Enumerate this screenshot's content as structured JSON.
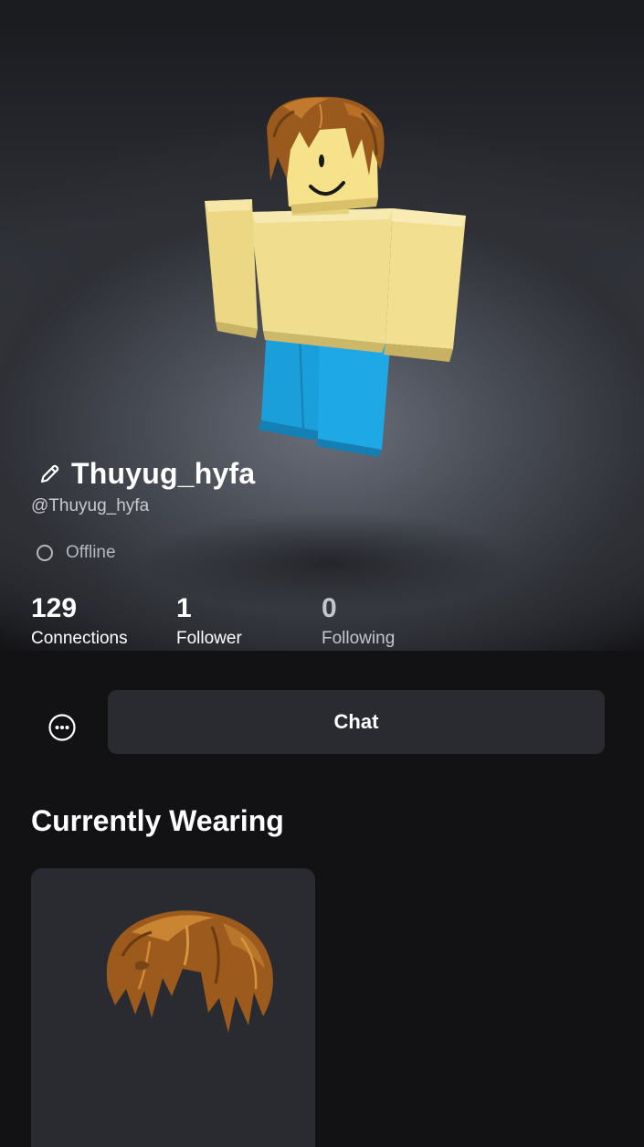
{
  "profile": {
    "display_name": "Thuyug_hyfa",
    "username": "@Thuyug_hyfa",
    "status": "Offline"
  },
  "stats": [
    {
      "value": "129",
      "label": "Connections"
    },
    {
      "value": "1",
      "label": "Follower"
    },
    {
      "value": "0",
      "label": "Following"
    }
  ],
  "actions": {
    "chat_label": "Chat",
    "more_icon": "more-options-icon"
  },
  "wearing": {
    "title": "Currently Wearing",
    "items": [
      {
        "icon": "brown-hair-accessory"
      }
    ]
  },
  "colors": {
    "background": "#121215",
    "button": "#2a2b31",
    "avatar_torso": "#f0dd8e",
    "avatar_legs": "#1aa3e0",
    "avatar_hair": "#9a5a1e"
  }
}
